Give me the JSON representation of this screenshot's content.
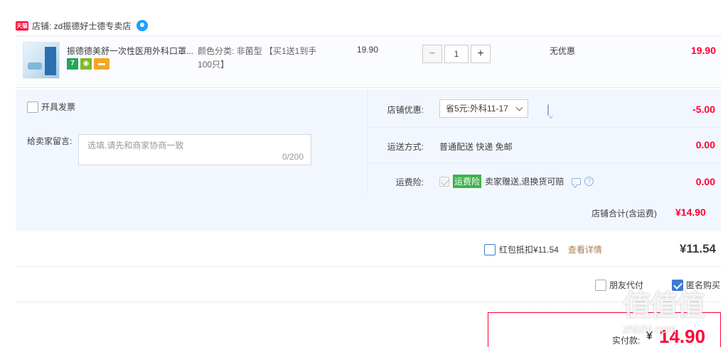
{
  "shop": {
    "badge": "天猫",
    "label": "店铺: zd振德好士德专卖店"
  },
  "item": {
    "title": "振德德美舒一次性医用外科口罩...",
    "service_icons": [
      "7",
      "shield-icon",
      "card-icon"
    ],
    "sku_line1": "颜色分类: 非菌型 【买1送1到手",
    "sku_line2": "100只】",
    "unit_price": "19.90",
    "quantity": "1",
    "qty_minus": "−",
    "qty_plus": "+",
    "discount": "无优惠",
    "total": "19.90"
  },
  "options": {
    "invoice_label": "开具发票",
    "memo_label": "给卖家留言:",
    "memo_placeholder": "选填,请先和商家协商一致",
    "memo_count": "0/200",
    "promo_label": "店铺优惠:",
    "promo_value": "省5元:外科11-17",
    "promo_amount": "-5.00",
    "shipping_label": "运送方式:",
    "shipping_value": "普通配送 快递 免邮",
    "shipping_amount": "0.00",
    "insurance_label": "运费险:",
    "insurance_tag": "运费险",
    "insurance_text": "卖家赠送,退换货可赔",
    "insurance_amount": "0.00",
    "shop_total_label": "店铺合计(含运费)",
    "shop_total_amount": "¥14.90"
  },
  "red_packet": {
    "label": "红包抵扣¥11.54",
    "link": "查看详情",
    "amount": "¥11.54"
  },
  "pay_options": {
    "friend_pay": "朋友代付",
    "anonymous": "匿名购买"
  },
  "actual_pay": {
    "label": "实付款:",
    "currency": "¥",
    "amount": "14.90"
  },
  "watermark": {
    "logo": "值值值",
    "site": "zhizhi.com"
  },
  "colors": {
    "accent_red": "#ff0036",
    "panel_bg": "#f2f7ff",
    "link_brown": "#a87c4f",
    "checkbox_blue": "#3a7bd5"
  }
}
